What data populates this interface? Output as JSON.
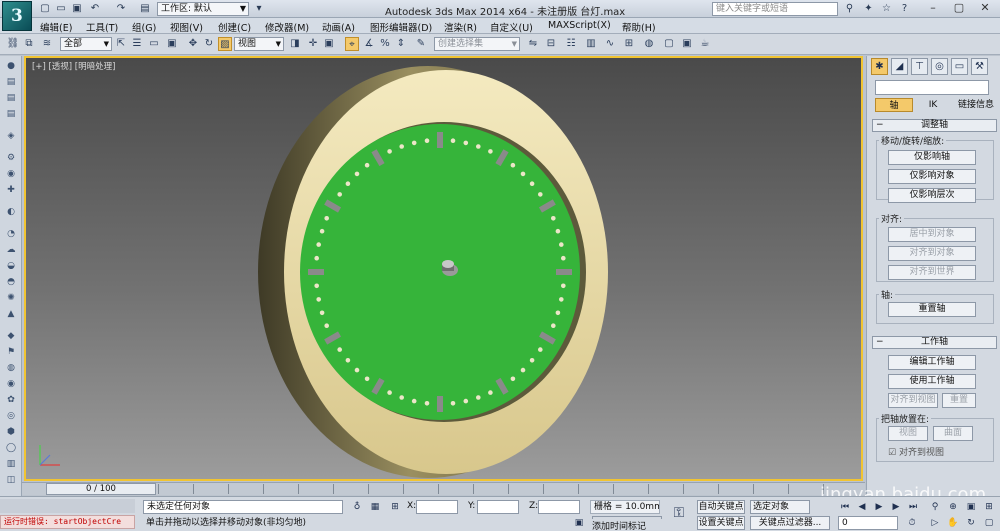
{
  "titlebar": {
    "workspace_label": "工作区: 默认",
    "title": "Autodesk 3ds Max  2014 x64  - 未注册版   台灯.max",
    "search_placeholder": "键入关键字或短语"
  },
  "menu": [
    "编辑(E)",
    "工具(T)",
    "组(G)",
    "视图(V)",
    "创建(C)",
    "修改器(M)",
    "动画(A)",
    "图形编辑器(D)",
    "渲染(R)",
    "自定义(U)",
    "MAXScript(X)",
    "帮助(H)"
  ],
  "toolbar": {
    "filter": "全部",
    "ref_coord": "视图",
    "selection_set_placeholder": "创建选择集"
  },
  "viewport": {
    "label": "[+] [透视] [明暗处理]"
  },
  "command_panel": {
    "subtabs": [
      "轴",
      "IK",
      "链接信息"
    ],
    "adjust_pivot": {
      "title": "调整轴",
      "move_group": "移动/旋转/缩放:",
      "buttons": [
        "仅影响轴",
        "仅影响对象",
        "仅影响层次"
      ],
      "align_group": "对齐:",
      "align_buttons": [
        "居中到对象",
        "对齐到对象",
        "对齐到世界"
      ],
      "pivot_group": "轴:",
      "reset_button": "重置轴"
    },
    "working_pivot": {
      "title": "工作轴",
      "buttons": [
        "编辑工作轴",
        "使用工作轴"
      ],
      "align_view": "对齐到视图",
      "reset": "重置",
      "place_group": "把轴放置在:",
      "view": "视图",
      "surface": "曲面",
      "align_checkbox": "对齐到视图"
    }
  },
  "timeline": {
    "frame": "0 / 100"
  },
  "status": {
    "script_error": "运行时错误: startObjectCre",
    "selection": "未选定任何对象",
    "prompt": "单击并拖动以选择并移动对象(非均匀地)",
    "x_label": "X:",
    "y_label": "Y:",
    "z_label": "Z:",
    "grid": "栅格 = 10.0mm",
    "auto_key": "自动关键点",
    "selected": "选定对象",
    "set_key": "设置关键点",
    "key_filter": "关键点过滤器...",
    "add_time_tag": "添加时间标记",
    "frame_value": "0"
  },
  "watermark": "jingyan.baidu.com",
  "colors": {
    "clock_face": "#36b43a",
    "rim": "#e6d497",
    "viewport_border": "#f1c431",
    "active_button": "#f4c96a"
  }
}
